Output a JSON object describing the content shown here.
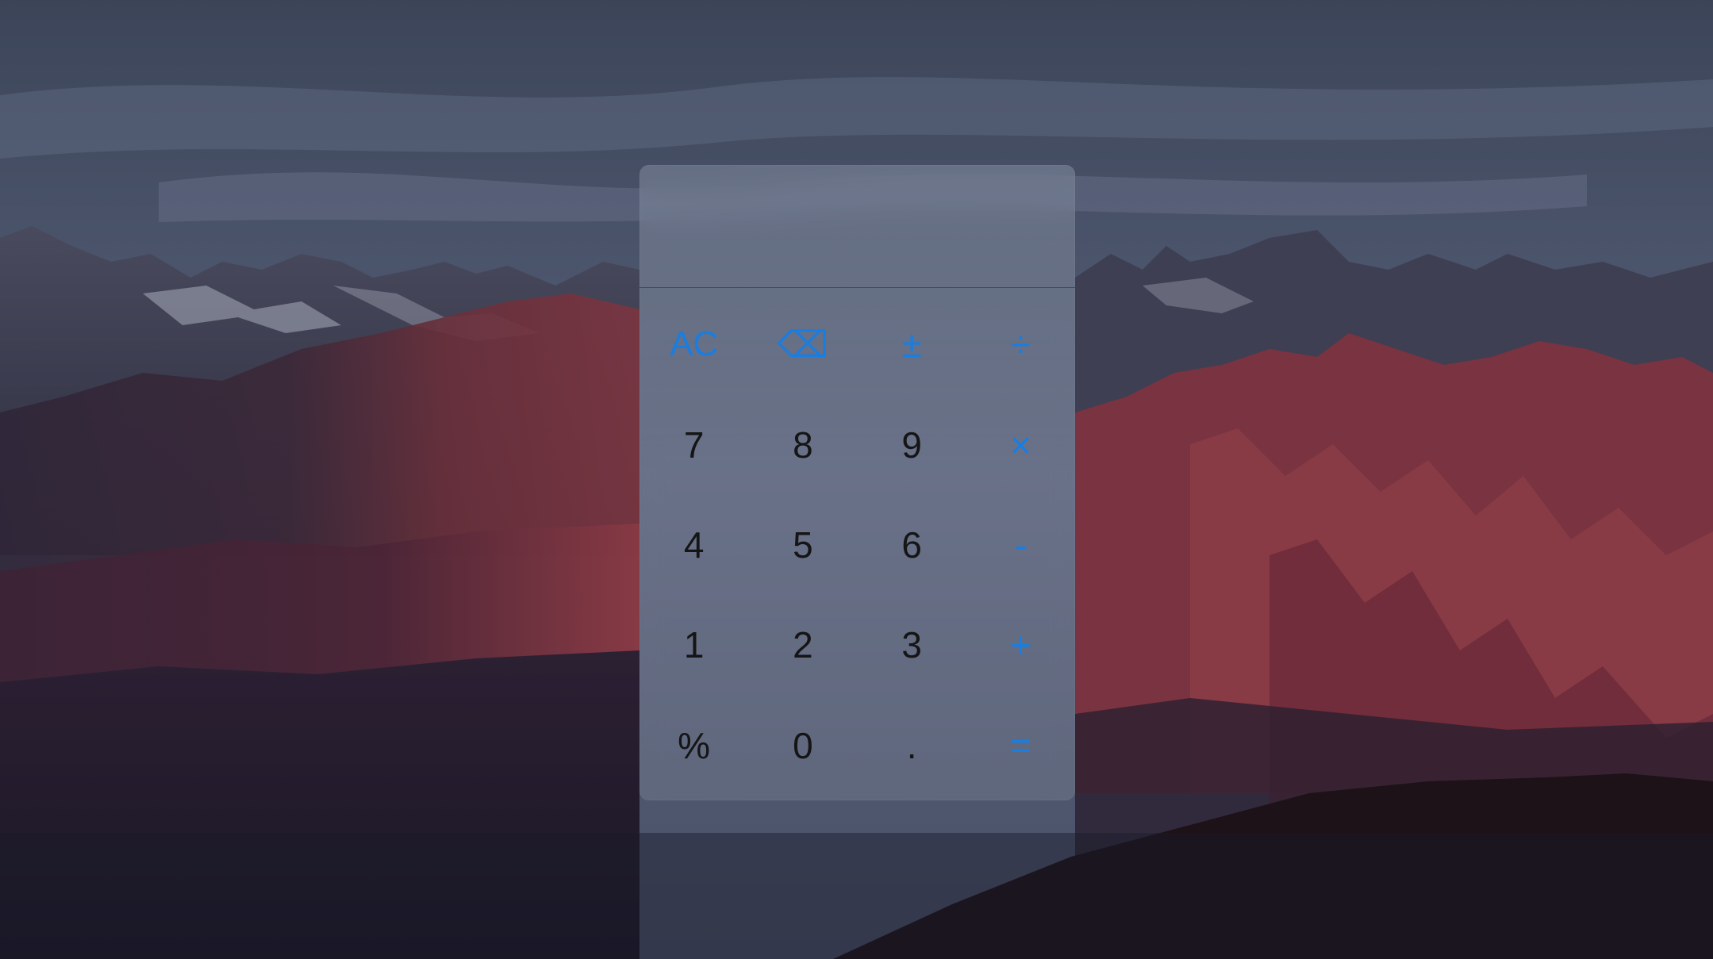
{
  "display": {
    "value": ""
  },
  "keys": [
    {
      "label": "AC",
      "name": "clear-button",
      "kind": "ac"
    },
    {
      "label": "⌫",
      "name": "backspace-button",
      "kind": "op"
    },
    {
      "label": "±",
      "name": "plus-minus-button",
      "kind": "op"
    },
    {
      "label": "÷",
      "name": "divide-button",
      "kind": "op"
    },
    {
      "label": "7",
      "name": "digit-7-button",
      "kind": "num"
    },
    {
      "label": "8",
      "name": "digit-8-button",
      "kind": "num"
    },
    {
      "label": "9",
      "name": "digit-9-button",
      "kind": "num"
    },
    {
      "label": "×",
      "name": "multiply-button",
      "kind": "op"
    },
    {
      "label": "4",
      "name": "digit-4-button",
      "kind": "num"
    },
    {
      "label": "5",
      "name": "digit-5-button",
      "kind": "num"
    },
    {
      "label": "6",
      "name": "digit-6-button",
      "kind": "num"
    },
    {
      "label": "-",
      "name": "subtract-button",
      "kind": "op"
    },
    {
      "label": "1",
      "name": "digit-1-button",
      "kind": "num"
    },
    {
      "label": "2",
      "name": "digit-2-button",
      "kind": "num"
    },
    {
      "label": "3",
      "name": "digit-3-button",
      "kind": "num"
    },
    {
      "label": "+",
      "name": "add-button",
      "kind": "op"
    },
    {
      "label": "%",
      "name": "percent-button",
      "kind": "num"
    },
    {
      "label": "0",
      "name": "digit-0-button",
      "kind": "num"
    },
    {
      "label": ".",
      "name": "decimal-point-button",
      "kind": "num"
    },
    {
      "label": "=",
      "name": "equals-button",
      "kind": "op"
    }
  ],
  "colors": {
    "operator": "#1a7de0",
    "digit": "#151515"
  }
}
